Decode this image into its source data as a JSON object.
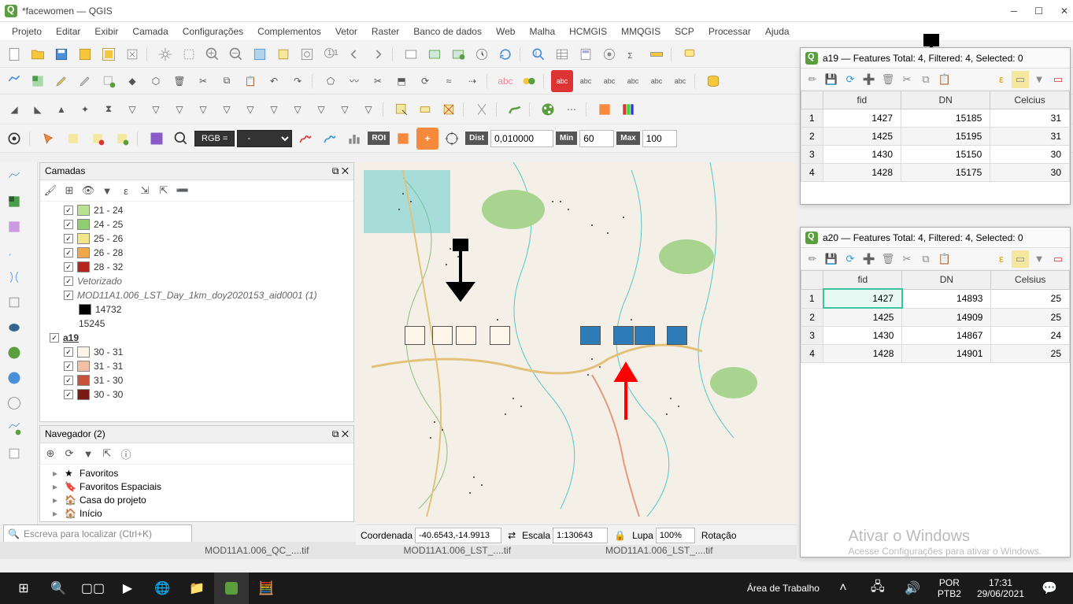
{
  "titlebar": {
    "title": "*facewomen — QGIS"
  },
  "menu": {
    "items": [
      "Projeto",
      "Editar",
      "Exibir",
      "Camada",
      "Configurações",
      "Complementos",
      "Vetor",
      "Raster",
      "Banco de dados",
      "Web",
      "Malha",
      "HCMGIS",
      "MMQGIS",
      "SCP",
      "Processar",
      "Ajuda"
    ]
  },
  "layers_panel": {
    "title": "Camadas",
    "items": [
      {
        "type": "legend",
        "color": "#b9e38f",
        "label": "21 - 24"
      },
      {
        "type": "legend",
        "color": "#8fcf6f",
        "label": "24 - 25"
      },
      {
        "type": "legend",
        "color": "#f2e58a",
        "label": "25 - 26"
      },
      {
        "type": "legend",
        "color": "#f2a74a",
        "label": "26 - 28"
      },
      {
        "type": "legend",
        "color": "#b5271e",
        "label": "28 - 32"
      },
      {
        "type": "layer",
        "italic": true,
        "label": "Vetorizado"
      },
      {
        "type": "layer",
        "italic": true,
        "label": "MOD11A1.006_LST_Day_1km_doy2020153_aid0001 (1)"
      },
      {
        "type": "legend",
        "color": "#000000",
        "label": "14732",
        "nocheck": true
      },
      {
        "type": "plain",
        "label": "15245"
      },
      {
        "type": "group",
        "bold": true,
        "label": "a19"
      },
      {
        "type": "legend",
        "color": "#fdf5e8",
        "label": "30 - 31"
      },
      {
        "type": "legend",
        "color": "#f2c1a3",
        "label": "31 - 31"
      },
      {
        "type": "legend",
        "color": "#c9533a",
        "label": "31 - 30"
      },
      {
        "type": "legend",
        "color": "#7a1a12",
        "label": "30 - 30"
      }
    ]
  },
  "browser_panel": {
    "title": "Navegador (2)",
    "items": [
      {
        "icon": "star",
        "label": "Favoritos"
      },
      {
        "icon": "bookmark",
        "label": "Favoritos Espaciais"
      },
      {
        "icon": "home",
        "label": "Casa do projeto"
      },
      {
        "icon": "home",
        "label": "Início"
      }
    ]
  },
  "locator": {
    "placeholder": "Escreva para localizar (Ctrl+K)"
  },
  "toolbar3": {
    "rgb_label": "RGB =",
    "rgb_value": "-",
    "roi_label": "ROI",
    "dist_label": "Dist",
    "dist_value": "0,010000",
    "min_label": "Min",
    "min_value": "60",
    "max_label": "Max",
    "max_value": "100"
  },
  "statusbar": {
    "coord_label": "Coordenada",
    "coord_value": "-40.6543,-14.9913",
    "scale_label": "Escala",
    "scale_value": "1:130643",
    "lupa_label": "Lupa",
    "lupa_value": "100%",
    "rot_label": "Rotação"
  },
  "attr_a19": {
    "title": "a19 — Features Total: 4, Filtered: 4, Selected: 0",
    "headers": [
      "fid",
      "DN",
      "Celcius"
    ],
    "rows": [
      [
        "1427",
        "15185",
        "31"
      ],
      [
        "1425",
        "15195",
        "31"
      ],
      [
        "1430",
        "15150",
        "30"
      ],
      [
        "1428",
        "15175",
        "30"
      ]
    ]
  },
  "attr_a20": {
    "title": "a20 — Features Total: 4, Filtered: 4, Selected: 0",
    "headers": [
      "fid",
      "DN",
      "Celsius"
    ],
    "rows": [
      [
        "1427",
        "14893",
        "25"
      ],
      [
        "1425",
        "14909",
        "25"
      ],
      [
        "1430",
        "14867",
        "24"
      ],
      [
        "1428",
        "14901",
        "25"
      ]
    ]
  },
  "watermark": {
    "line1": "Ativar o Windows",
    "line2": "Acesse Configurações para ativar o Windows."
  },
  "bgtabs": {
    "t1": "MOD11A1.006_QC_....tif",
    "t2": "MOD11A1.006_LST_....tif",
    "t3": "MOD11A1.006_LST_....tif"
  },
  "taskbar": {
    "desk": "Área de Trabalho",
    "lang1": "POR",
    "lang2": "PTB2",
    "time": "17:31",
    "date": "29/06/2021"
  }
}
